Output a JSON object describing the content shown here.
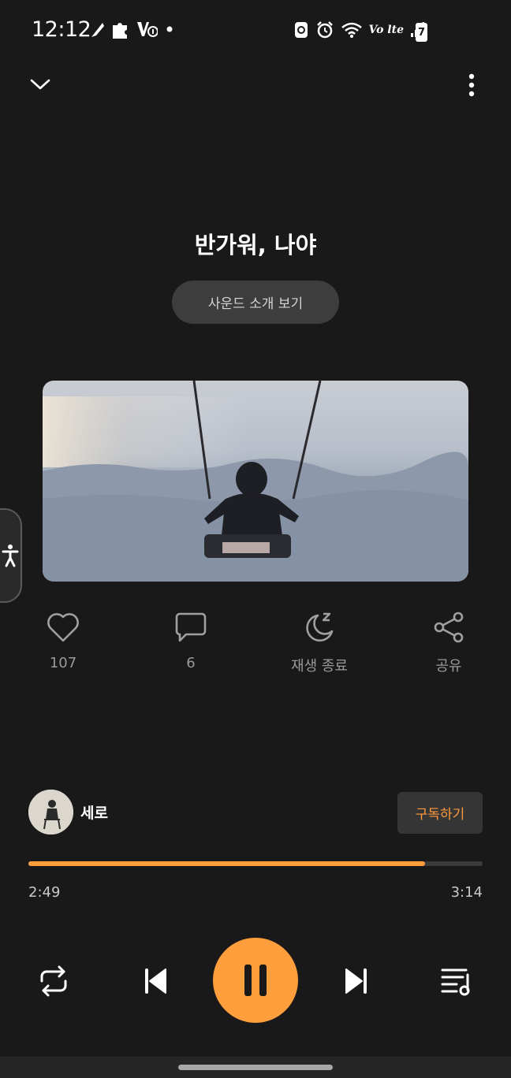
{
  "status_bar": {
    "time": "12:12",
    "network_label": "Vo lte",
    "battery_level": "7",
    "left_icons": [
      "feather-icon",
      "puzzle-icon",
      "vpn-key-icon",
      "dot-icon"
    ],
    "right_icons": [
      "recycle-icon",
      "alarm-icon",
      "wifi-icon",
      "volte-icon",
      "signal-icon",
      "battery-icon"
    ]
  },
  "header": {
    "collapse_icon": "chevron-down-icon",
    "more_icon": "more-vertical-icon"
  },
  "track": {
    "title": "반가워, 나야",
    "intro_button": "사운드 소개 보기"
  },
  "actions": [
    {
      "icon": "heart-icon",
      "label": "107"
    },
    {
      "icon": "comment-icon",
      "label": "6"
    },
    {
      "icon": "sleep-timer-icon",
      "label": "재생 종료"
    },
    {
      "icon": "share-icon",
      "label": "공유"
    }
  ],
  "creator": {
    "name": "세로",
    "subscribe_label": "구독하기"
  },
  "playback": {
    "current_time": "2:49",
    "total_time": "3:14",
    "progress": 0.873
  },
  "controls": [
    "repeat-icon",
    "previous-icon",
    "pause-icon",
    "next-icon",
    "playlist-icon"
  ],
  "colors": {
    "accent": "#ff9e3d",
    "background": "#191919",
    "pill": "#3d3d3d"
  }
}
